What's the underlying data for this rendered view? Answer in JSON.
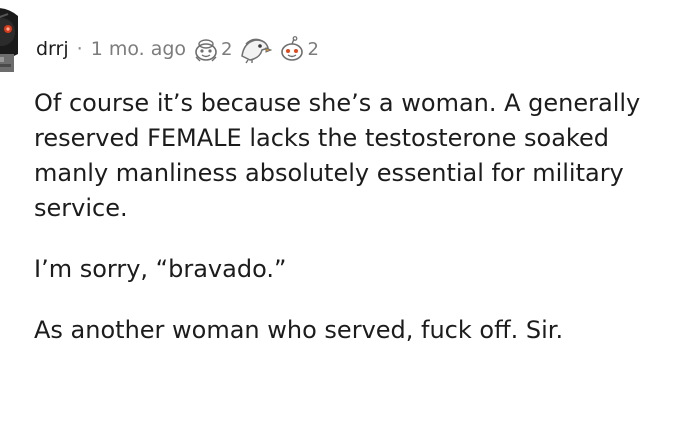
{
  "comment": {
    "username": "drrj",
    "separator": "·",
    "timestamp": "1 mo. ago",
    "awards": [
      {
        "icon": "wholesome-award-icon",
        "count": "2"
      },
      {
        "icon": "bird-award-icon",
        "count": ""
      },
      {
        "icon": "helpful-award-icon",
        "count": "2"
      }
    ],
    "paragraphs": [
      {
        "lines": [
          "Of course it’s because she’s a woman. A generally",
          "reserved FEMALE lacks the testosterone soaked",
          "manly manliness absolutely essential for military",
          "service."
        ]
      },
      {
        "lines": [
          "I’m sorry, “bravado.”"
        ]
      },
      {
        "lines": [
          "As another woman who served, fuck off. Sir."
        ]
      }
    ]
  }
}
